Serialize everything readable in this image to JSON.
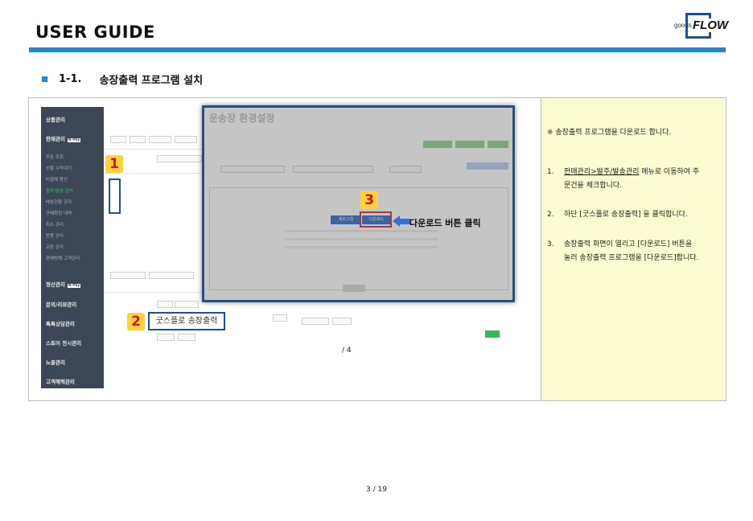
{
  "header": {
    "title": "USER GUIDE",
    "logo_small": "goods",
    "logo_big": "FLOW"
  },
  "section": {
    "number": "1-1.",
    "title": "송장출력 프로그램 설치"
  },
  "screenshot": {
    "sidebar": {
      "items": [
        {
          "label": "상품관리"
        },
        {
          "label": "판매관리",
          "badge": "N Pay"
        },
        {
          "label": "정산관리",
          "badge": "N Pay"
        },
        {
          "label": "문의/리뷰관리"
        },
        {
          "label": "톡톡상담관리"
        },
        {
          "label": "스토어 전시관리"
        },
        {
          "label": "노출관리"
        },
        {
          "label": "고객혜택관리"
        }
      ],
      "subitems": [
        "주문 조회",
        "선물 수락대기",
        "미결제 확인",
        "발주/발송 관리",
        "배송현황 관리",
        "구매확정 내역",
        "취소 관리",
        "반품 관리",
        "교환 관리",
        "판매방해 고객관리"
      ]
    },
    "dialog": {
      "title": "운송장 환경설정",
      "btn_seq": "새로고침",
      "btn_download": "다운로드",
      "callout": "다운로드 버튼 클릭"
    },
    "markers": [
      "1",
      "2",
      "3"
    ],
    "label_box": "굿스플로 송장출력",
    "page_indicator": "/ 4"
  },
  "notes": {
    "intro": "※ 송장출력 프로그램을 다운로드 합니다.",
    "steps": [
      {
        "num": "1.",
        "lines": [
          "판매관리>발주/발송관리 메뉴로 이동하여 주",
          "문건을 체크합니다."
        ],
        "underline": "판매관리>발주/발송관리"
      },
      {
        "num": "2.",
        "lines": [
          "하단 [굿스플로 송장출력] 을 클릭합니다."
        ]
      },
      {
        "num": "3.",
        "lines": [
          "송장출력 화면이 열리고 [다운로드] 버튼을",
          "눌러 송장출력 프로그램을 [다운로드]합니다."
        ]
      }
    ]
  },
  "footer": {
    "page": "3 / 19"
  }
}
